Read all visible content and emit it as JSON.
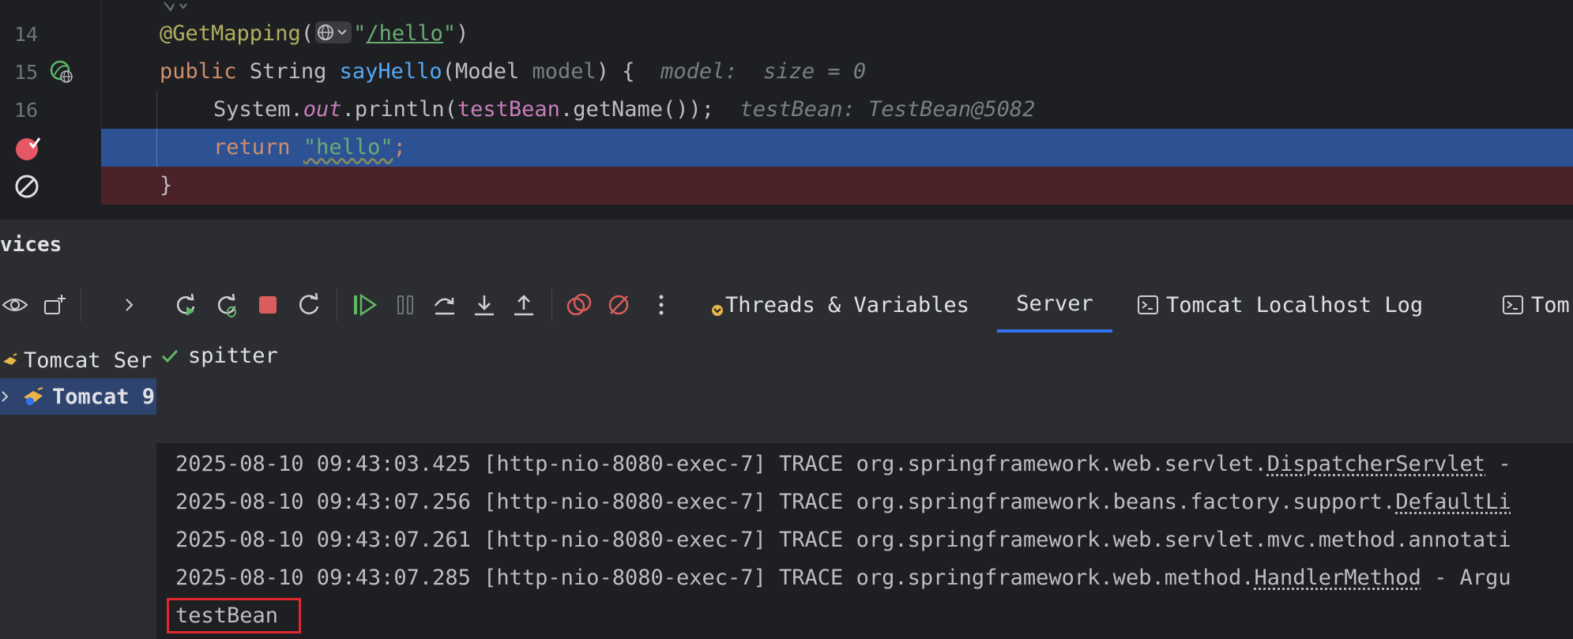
{
  "editor": {
    "lines": [
      {
        "num": "14",
        "annotation": "@GetMapping",
        "paren_open": "(",
        "url_quote_open": "\"",
        "url": "/hello",
        "url_quote_close": "\"",
        "paren_close": ")"
      },
      {
        "num": "15",
        "kw": "public",
        "type": "String",
        "method": "sayHello",
        "open": "(",
        "ptype": "Model",
        "pname": "model",
        "close": ") {",
        "hint": "model:  size = 0"
      },
      {
        "num": "16",
        "cls": "System.",
        "field": "out",
        "call": ".println(",
        "var": "testBean",
        "rest": ".getName());",
        "hint": "testBean: TestBean@5082"
      },
      {
        "num": "",
        "kw": "return",
        "str": "\"hello\"",
        "semi": ";"
      },
      {
        "num": "",
        "brace": "}"
      }
    ]
  },
  "services": {
    "title": "vices",
    "tree": {
      "items": [
        {
          "label": "Tomcat Ser"
        },
        {
          "label": "Tomcat 9"
        }
      ]
    },
    "tabs": [
      {
        "label": "Threads & Variables"
      },
      {
        "label": "Server"
      },
      {
        "label": "Tomcat Localhost Log"
      },
      {
        "label": "Tom"
      }
    ],
    "deployment": {
      "name": "spitter"
    },
    "log": [
      {
        "ts": "2025-08-10 09:43:03.425",
        "thread": "[http-nio-8080-exec-7]",
        "level": "TRACE",
        "pkg": "org.springframework.web.servlet.",
        "cls": "DispatcherServlet",
        "rest": " -"
      },
      {
        "ts": "2025-08-10 09:43:07.256",
        "thread": "[http-nio-8080-exec-7]",
        "level": "TRACE",
        "pkg": "org.springframework.beans.factory.support.",
        "cls": "DefaultLi",
        "rest": ""
      },
      {
        "ts": "2025-08-10 09:43:07.261",
        "thread": "[http-nio-8080-exec-7]",
        "level": "TRACE",
        "pkg": "org.springframework.web.servlet.mvc.method.annotati",
        "cls": "",
        "rest": ""
      },
      {
        "ts": "2025-08-10 09:43:07.285",
        "thread": "[http-nio-8080-exec-7]",
        "level": "TRACE",
        "pkg": "org.springframework.web.method.",
        "cls": "HandlerMethod",
        "rest": " - Argu"
      }
    ],
    "output_value": "testBean"
  },
  "colors": {
    "accent": "#3574f0",
    "breakpoint": "#e55765",
    "current_line": "#2d5294",
    "highlight_box": "#e0282e",
    "run_green": "#5fb865",
    "stop_red": "#db5c5c"
  },
  "icons": {
    "gutter_15": "spring-web-endpoint-icon",
    "gutter_bp": "breakpoint-icon",
    "gutter_muted": "mute-breakpoints-icon",
    "toolbar": [
      "eye-icon",
      "new-service-icon",
      "chevron-right-icon",
      "rerun-icon",
      "rerun-debug-icon",
      "stop-icon",
      "update-icon",
      "resume-icon",
      "pause-icon",
      "step-over-icon",
      "step-into-icon",
      "step-out-icon",
      "view-breakpoints-icon",
      "mute-breakpoints-icon",
      "more-icon"
    ]
  }
}
